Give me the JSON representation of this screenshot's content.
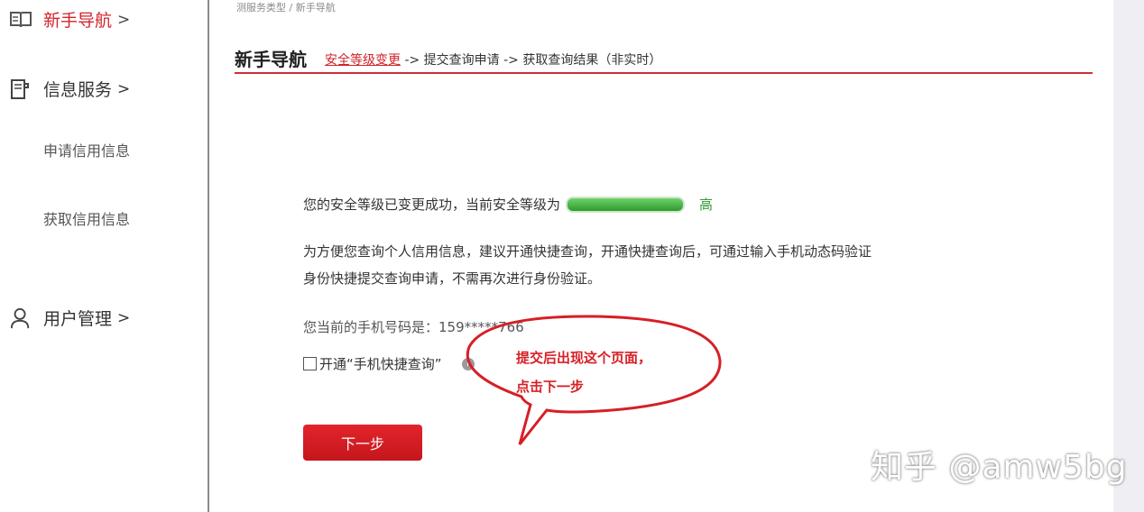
{
  "sidebar": {
    "guide": {
      "label": "新手导航",
      "chevron": ">"
    },
    "info": {
      "label": "信息服务",
      "chevron": ">"
    },
    "items": [
      {
        "label": "申请信用信息"
      },
      {
        "label": "获取信用信息"
      }
    ],
    "user": {
      "label": "用户管理",
      "chevron": ">"
    }
  },
  "breadcrumb": "测服务类型  /  新手导航",
  "header": {
    "title": "新手导航",
    "steps": {
      "active": "安全等级变更",
      "rest": " -> 提交查询申请 -> 获取查询结果（非实时）"
    }
  },
  "main": {
    "line1": "您的安全等级已变更成功，当前安全等级为",
    "level_word": "高",
    "line2": "为方便您查询个人信用信息，建议开通快捷查询，开通快捷查询后，可通过输入手机动态码验证",
    "line3": "身份快捷提交查询申请，不需再次进行身份验证。",
    "line4": "您当前的手机号码是：159*****766",
    "checkbox_label": "开通“手机快捷查询”",
    "info_icon": "i",
    "next_button": "下一步"
  },
  "annotation": {
    "line1": "提交后出现这个页面，",
    "line2": "点击下一步"
  },
  "watermark": "知乎 @amw5bg",
  "colors": {
    "accent": "#d0242b",
    "level_green": "#2f9a30",
    "sidebar_divider": "#8a8a8a"
  }
}
